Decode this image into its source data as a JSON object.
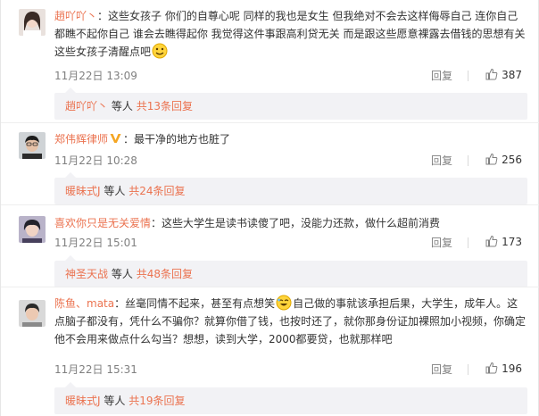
{
  "comments": [
    {
      "user": "趙吖吖丶",
      "text_before_emoji": "：这些女孩子 你们的自尊心呢 同样的我也是女生 但我绝对不会去这样侮辱自己 连你自己都瞧不起你自己 谁会去瞧得起你 我觉得这件事跟高利贷无关 而是跟这些愿意裸露去借钱的思想有关 这些女孩子清醒点吧",
      "text_after_emoji": "",
      "time": "11月22日 13:09",
      "reply_label": "回复",
      "likes": "387",
      "reply_user": "趙吖吖丶",
      "reply_others": "等人",
      "reply_count": "共13条回复",
      "emoji": "smile-emoji"
    },
    {
      "user": "郑伟辉律师",
      "text": "：最干净的地方也脏了",
      "time": "11月22日 10:28",
      "reply_label": "回复",
      "likes": "256",
      "reply_user": "暖昧式J",
      "reply_others": "等人",
      "reply_count": "共24条回复",
      "verified_color": "#f5a623"
    },
    {
      "user": "喜欢你只是无关爱情",
      "text": "：这些大学生是读书读傻了吧，没能力还款，做什么超前消费",
      "time": "11月22日 15:01",
      "reply_label": "回复",
      "likes": "173",
      "reply_user": "神圣天战",
      "reply_others": "等人",
      "reply_count": "共48条回复"
    },
    {
      "user": "陈鱼、mata",
      "text_before_emoji": "：丝毫同情不起来，甚至有点想笑",
      "text_after_emoji": "自己做的事就该承担后果，大学生，成年人。这点脑子都没有，凭什么不骗你？就算你借了钱，也按时还了，就你那身份证加裸照加小视频，你确定他不会用来做点什么勾当？想想，读到大学，2000都要贷，也就那样吧",
      "time": "11月22日 15:31",
      "reply_label": "回复",
      "likes": "196",
      "reply_user": "暖昧式J",
      "reply_others": "等人",
      "reply_count": "共19条回复",
      "emoji": "laugh-emoji"
    }
  ],
  "colors": {
    "link": "#eb7350",
    "meta": "#808080",
    "reply_bg": "#f2f2f5"
  }
}
